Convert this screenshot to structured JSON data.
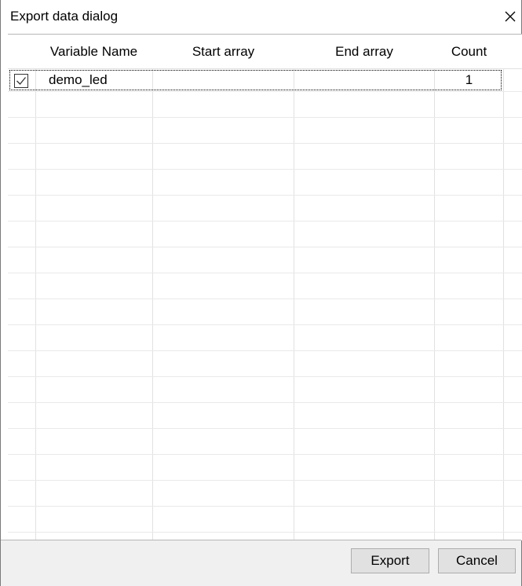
{
  "window": {
    "title": "Export data dialog",
    "close_icon": "close-icon"
  },
  "table": {
    "columns": [
      "",
      "Variable Name",
      "Start array",
      "End array",
      "Count"
    ],
    "rows": [
      {
        "checked": true,
        "variable_name": "demo_led",
        "start_array": "",
        "end_array": "",
        "count": "1"
      }
    ]
  },
  "buttons": {
    "export_label": "Export",
    "cancel_label": "Cancel"
  },
  "colors": {
    "footer_bg": "#f0f0f0",
    "grid_line": "#e1e1e1",
    "button_bg": "#e1e1e1"
  }
}
